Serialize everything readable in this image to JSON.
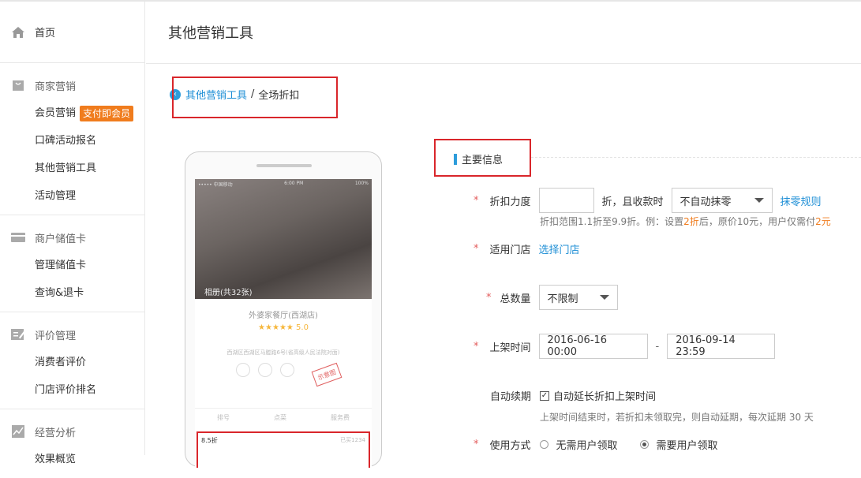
{
  "sidebar": {
    "home": "首页",
    "groups": [
      {
        "title": "商家营销",
        "icon": "bag-icon",
        "items": [
          "会员营销",
          "口碑活动报名",
          "其他营销工具",
          "活动管理"
        ],
        "badge": "支付即会员"
      },
      {
        "title": "商户储值卡",
        "icon": "card-icon",
        "items": [
          "管理储值卡",
          "查询&退卡"
        ]
      },
      {
        "title": "评价管理",
        "icon": "edit-icon",
        "items": [
          "消费者评价",
          "门店评价排名"
        ]
      },
      {
        "title": "经营分析",
        "icon": "chart-icon",
        "items": [
          "效果概览"
        ]
      }
    ]
  },
  "page": {
    "title": "其他营销工具"
  },
  "breadcrumb": {
    "parent": "其他营销工具",
    "separator": "/",
    "current": "全场折扣"
  },
  "phone": {
    "status_left": "••••• 中国移动",
    "status_time": "6:00 PM",
    "status_right": "100%",
    "photo_label": "相册(共32张)",
    "shop_name": "外婆家餐厅(西湖店)",
    "stars": "★★★★★ 5.0",
    "address": "西湖区西湖区马塍路6号(省高级人民法院对面)",
    "stamp": "示意图",
    "tabs": [
      "排号",
      "点菜",
      "服务费"
    ],
    "deal_label": "8.5折",
    "deal_sold": "已买1234"
  },
  "form": {
    "section_title": "主要信息",
    "discount": {
      "label": "折扣力度",
      "value": "",
      "after": "折，且收款时",
      "select": "不自动抹零",
      "rule_link": "抹零规则"
    },
    "discount_hint": {
      "p1": "折扣范围1.1折至9.9折。例：设置",
      "v1": "2折",
      "p2": "后，原价10元，用户仅需付",
      "v2": "2元"
    },
    "store": {
      "label": "适用门店",
      "link": "选择门店"
    },
    "quantity": {
      "label": "总数量",
      "select": "不限制"
    },
    "time": {
      "label": "上架时间",
      "start": "2016-06-16 00:00",
      "dash": "-",
      "end": "2016-09-14 23:59"
    },
    "renew": {
      "label": "自动续期",
      "checkbox": "自动延长折扣上架时间",
      "hint": "上架时间结束时，若折扣未领取完，则自动延期，每次延期 30 天"
    },
    "usage": {
      "label": "使用方式",
      "opt1": "无需用户领取",
      "opt2": "需要用户领取"
    }
  },
  "colors": {
    "accent": "#1f8fd6",
    "highlight": "#d9262b",
    "badge": "#f07c1d"
  }
}
